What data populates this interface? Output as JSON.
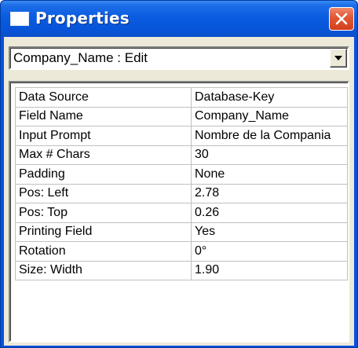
{
  "window": {
    "title": "Properties",
    "close_label": "close"
  },
  "object_selector": {
    "value": "Company_Name : Edit"
  },
  "properties": [
    {
      "name": "Data Source",
      "value": "Database-Key"
    },
    {
      "name": "Field Name",
      "value": "Company_Name"
    },
    {
      "name": "Input Prompt",
      "value": "Nombre de la Compania"
    },
    {
      "name": "Max # Chars",
      "value": "30"
    },
    {
      "name": "Padding",
      "value": "None"
    },
    {
      "name": "Pos: Left",
      "value": "2.78"
    },
    {
      "name": "Pos: Top",
      "value": "0.26"
    },
    {
      "name": "Printing Field",
      "value": "Yes"
    },
    {
      "name": "Rotation",
      "value": "0°"
    },
    {
      "name": "Size: Width",
      "value": "1.90"
    }
  ],
  "icons": {
    "window_icon": "window-icon",
    "close": "close-icon",
    "dropdown": "chevron-down-icon"
  },
  "colors": {
    "titlebar": "#0a5ce0",
    "close_button": "#e25a36",
    "client_background": "#ece9d8",
    "grid_line": "#c0c0c0"
  }
}
